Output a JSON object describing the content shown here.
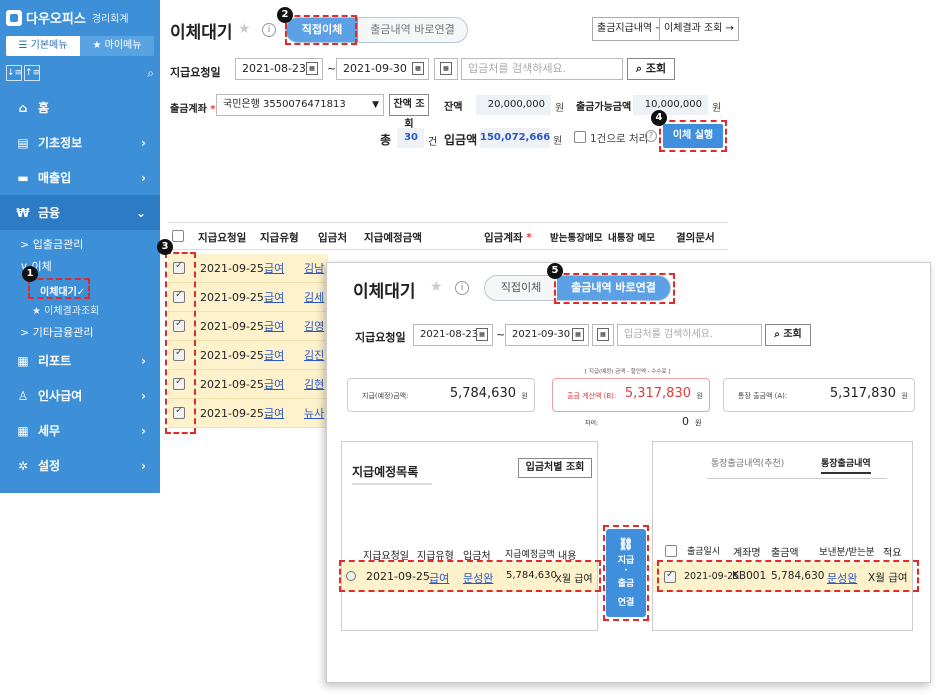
{
  "app": {
    "name": "다우오피스",
    "sub": "경리회계"
  },
  "sidebar": {
    "toggle_basic": "☰ 기본메뉴",
    "toggle_my": "★ 마이메뉴",
    "tool1": "↓≡",
    "tool2": "↑≡",
    "items": [
      {
        "label": "홈",
        "icon": "⌂"
      },
      {
        "label": "기초정보",
        "icon": "▤"
      },
      {
        "label": "매출입",
        "icon": "▬"
      },
      {
        "label": "금융",
        "icon": "₩"
      },
      {
        "label": "리포트",
        "icon": "▦"
      },
      {
        "label": "인사급여",
        "icon": "♙"
      },
      {
        "label": "세무",
        "icon": "▦"
      },
      {
        "label": "설정",
        "icon": "✲"
      }
    ],
    "sub_deposit": "> 입출금관리",
    "sub_transfer": "∨ 이체",
    "sub_wait": "이체대기✓",
    "sub_result": "★ 이체결과조회",
    "sub_other": "> 기타금융관리"
  },
  "main": {
    "title": "이체대기",
    "tab_direct": "직접이체",
    "tab_link": "출금내역 바로연결",
    "btn_paylist": "출금지급내역 →",
    "btn_result": "이체결과 조회 →",
    "lbl_date": "지급요청일",
    "date_from": "2021-08-23",
    "date_to": "2021-09-30",
    "tilde": "~",
    "search_placeholder": "입금처를 검색하세요.",
    "search_btn": "조회",
    "lbl_account": "출금계좌",
    "account_value": "국민은행 3550076471813",
    "balance_btn": "잔액 조회",
    "lbl_balance": "잔액",
    "balance_value": "20,000,000",
    "lbl_available": "출금가능금액",
    "available_value": "10,000,000",
    "won": "원",
    "lbl_total": "총",
    "total_count": "30",
    "count_unit": "건",
    "lbl_amount": "입금액",
    "amount_value": "150,072,666",
    "single_process": "1건으로 처리",
    "exec_btn": "이체 실행",
    "required": "*"
  },
  "grid": {
    "headers": [
      "지급요청일",
      "지급유형",
      "입금처",
      "지급예정금액",
      "입금계좌",
      "받는통장메모",
      "내통장 메모",
      "결의문서"
    ],
    "rows": [
      {
        "date": "2021-09-25",
        "type": "급여",
        "name": "김남"
      },
      {
        "date": "2021-09-25",
        "type": "급여",
        "name": "김세"
      },
      {
        "date": "2021-09-25",
        "type": "급여",
        "name": "김영"
      },
      {
        "date": "2021-09-25",
        "type": "급여",
        "name": "김진"
      },
      {
        "date": "2021-09-25",
        "type": "급여",
        "name": "김현"
      },
      {
        "date": "2021-09-25",
        "type": "급여",
        "name": "뉴사"
      }
    ]
  },
  "markers": [
    "1",
    "2",
    "3",
    "4",
    "5"
  ],
  "popup": {
    "title": "이체대기",
    "tab_direct": "직접이체",
    "tab_link": "출금내역 바로연결",
    "lbl_date": "지급요청일",
    "date_from": "2021-08-23",
    "date_to": "2021-09-30",
    "search_placeholder": "입금처를 검색하세요.",
    "search_btn": "조회",
    "formula": "[ 지급(예정) 금액 - 할인액 - 수수료 ]",
    "sum1_label": "지급(예정)금액:",
    "sum1_value": "5,784,630",
    "sum2_label": "출금 계산액 (B):",
    "sum2_value": "5,317,830",
    "sum3_label": "통장 출금액 (A):",
    "sum3_value": "5,317,830",
    "won": "원",
    "diff_label": "차이:",
    "diff_value": "0",
    "left_title": "지급예정목록",
    "left_btn": "입금처별 조회",
    "left_headers": [
      "지급요청일",
      "지급유형",
      "입금처",
      "지급예정금액",
      "내용"
    ],
    "left_row": {
      "date": "2021-09-25",
      "type": "급여",
      "name": "문성완",
      "amount": "5,784,630",
      "content": "X월 급여"
    },
    "link_btn": [
      "지급",
      "·",
      "출금",
      "연결"
    ],
    "right_tab1": "통장출금내역(추천)",
    "right_tab2": "통장출금내역",
    "right_headers": [
      "출금일시",
      "계좌명",
      "출금액",
      "보낸분/받는분",
      "적요"
    ],
    "right_row": {
      "date": "2021-09-25",
      "account": "KB001",
      "amount": "5,784,630",
      "name": "문성완",
      "memo": "X월 급여"
    }
  }
}
